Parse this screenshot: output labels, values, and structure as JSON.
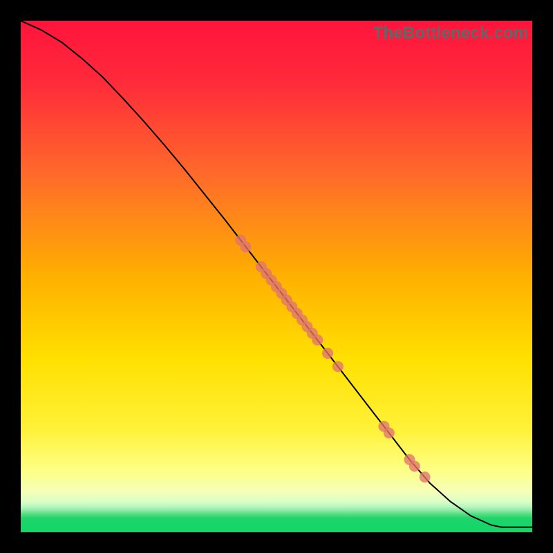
{
  "watermark": "TheBottleneck.com",
  "colors": {
    "page_bg": "#000000",
    "top_grad": "#ff143c",
    "mid_grad": "#ffd400",
    "lowlight": "#ffff8c",
    "green_band": "#16d66a",
    "curve": "#000000",
    "dot": "#e0746d"
  },
  "chart_data": {
    "type": "line",
    "title": "",
    "xlabel": "",
    "ylabel": "",
    "xlim": [
      0,
      100
    ],
    "ylim": [
      0,
      100
    ],
    "grid": false,
    "legend": null,
    "series": [
      {
        "name": "curve",
        "x": [
          0,
          4,
          8,
          12,
          16,
          20,
          24,
          28,
          32,
          36,
          40,
          44,
          48,
          52,
          56,
          60,
          64,
          68,
          72,
          76,
          80,
          84,
          88,
          92,
          94,
          100
        ],
        "y": [
          100,
          98.2,
          95.8,
          92.6,
          89.0,
          84.8,
          80.4,
          75.8,
          71.0,
          66.0,
          61.0,
          55.8,
          50.6,
          45.4,
          40.2,
          35.0,
          29.8,
          24.6,
          19.4,
          14.2,
          9.6,
          6.0,
          3.2,
          1.4,
          1.0,
          1.0
        ]
      }
    ],
    "points": {
      "name": "markers",
      "type": "scatter",
      "x": [
        43,
        44,
        47,
        48,
        49,
        50,
        51,
        52,
        53,
        54,
        55,
        56,
        57,
        58,
        60,
        62,
        71,
        72,
        76,
        77,
        79
      ],
      "y": [
        57.1,
        55.8,
        51.9,
        50.6,
        49.3,
        48.0,
        46.7,
        45.4,
        44.1,
        42.8,
        41.5,
        40.2,
        38.9,
        37.6,
        35.0,
        32.4,
        20.7,
        19.4,
        14.2,
        12.9,
        10.8
      ],
      "marker_radius": 8
    }
  }
}
